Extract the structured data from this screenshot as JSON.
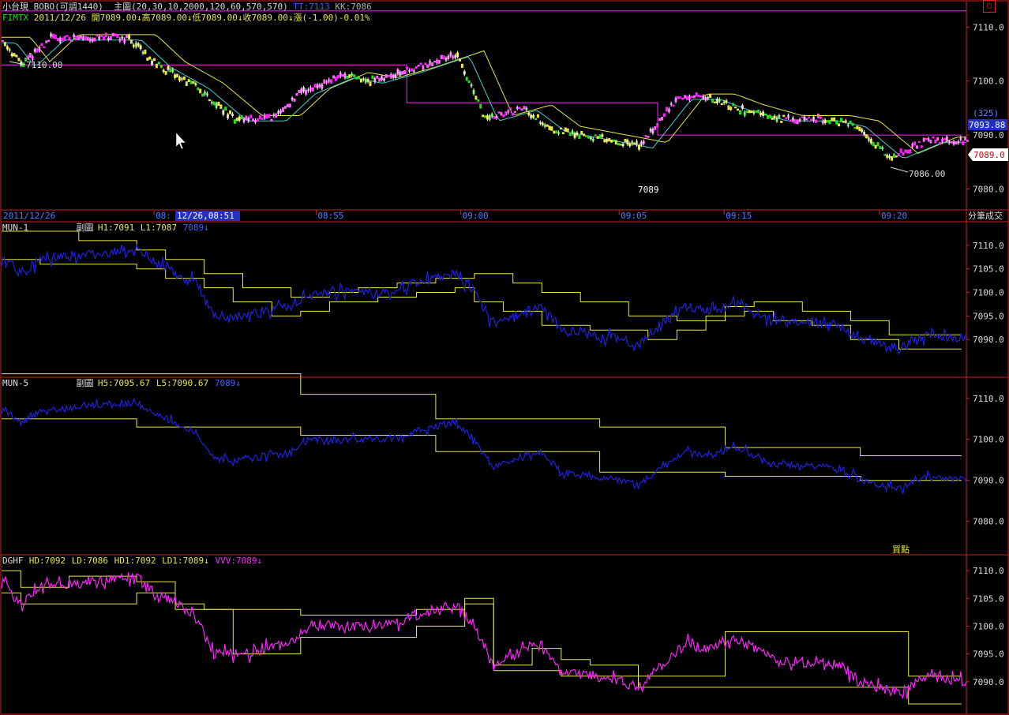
{
  "header": {
    "line1_title": "小台現",
    "line1_system": "BOBO(可調1440)",
    "line1_main": "主圖(20,30,10,2000,120,60,570,570)",
    "line1_tt": "TT:7113",
    "line1_kk": "KK:7086",
    "line2_symbol": "FIMTX",
    "line2_quote": "2011/12/26 開7089.00↓高7089.00↓低7089.00↓收7089.00↓漲(-1.00)-0.01%"
  },
  "colors": {
    "background": "#000000",
    "frame": "#cc2222",
    "yellow": "#e8e840",
    "blue": "#2020e0",
    "magenta": "#ff20ff",
    "green": "#20e020",
    "cyan": "#40d0d0",
    "axis_text": "#dddddd"
  },
  "time_axis": {
    "date": "2011/12/26",
    "cursor": "12/26,08:51",
    "ticks": [
      {
        "label": "08:",
        "t": 0.158
      },
      {
        "label": "08:55",
        "t": 0.326
      },
      {
        "label": "09:00",
        "t": 0.476
      },
      {
        "label": "09:05",
        "t": 0.64
      },
      {
        "label": "09:15",
        "t": 0.749
      },
      {
        "label": "09:20",
        "t": 0.91
      }
    ],
    "right_label": "分筆成交"
  },
  "panel1": {
    "annotation_high": "7110.00",
    "annotation_low": "7086.00",
    "annotation_price": "7089",
    "tag_count": "(325)",
    "tag_value": "7093.88",
    "tag_last": "7089.0"
  },
  "panel2": {
    "name": "MUN-1",
    "sub": "副圖",
    "h": "H1:7091",
    "l": "L1:7087",
    "v": "7089↓"
  },
  "panel3": {
    "name": "MUN-5",
    "sub": "副圖",
    "h": "H5:7095.67",
    "l": "L5:7090.67",
    "v": "7089↓",
    "signal": "買點"
  },
  "panel4": {
    "name": "DGHF",
    "hd": "HD:7092",
    "ld": "LD:7086",
    "hd1": "HD1:7092",
    "ld1": "LD1:7089↓",
    "vvv": "VVV:7089↓"
  },
  "chart_data": [
    {
      "type": "line",
      "name_panel": "main",
      "ylim": [
        7077,
        7114
      ],
      "yticks": [
        "7110.0",
        "7100.0",
        "7090.0",
        "7080.0"
      ],
      "ytick_values": [
        7110,
        7100,
        7090,
        7080
      ],
      "price_anchors": [
        [
          0,
          7107.5
        ],
        [
          0.02,
          7103
        ],
        [
          0.05,
          7108
        ],
        [
          0.13,
          7108
        ],
        [
          0.16,
          7103
        ],
        [
          0.2,
          7099
        ],
        [
          0.24,
          7093
        ],
        [
          0.28,
          7093
        ],
        [
          0.31,
          7098
        ],
        [
          0.35,
          7101
        ],
        [
          0.38,
          7100
        ],
        [
          0.42,
          7102
        ],
        [
          0.47,
          7105
        ],
        [
          0.5,
          7093
        ],
        [
          0.54,
          7095
        ],
        [
          0.57,
          7091
        ],
        [
          0.6,
          7090
        ],
        [
          0.66,
          7088
        ],
        [
          0.7,
          7097
        ],
        [
          0.73,
          7097
        ],
        [
          0.76,
          7095
        ],
        [
          0.8,
          7093
        ],
        [
          0.85,
          7093
        ],
        [
          0.88,
          7092
        ],
        [
          0.92,
          7086
        ],
        [
          0.96,
          7089
        ],
        [
          1.0,
          7089
        ]
      ],
      "upper_line": 7113,
      "lower_steps": [
        [
          0,
          7103
        ],
        [
          0.42,
          7096
        ],
        [
          0.68,
          7090
        ]
      ]
    },
    {
      "type": "line",
      "name_panel": "MUN-1",
      "ylim": [
        7083,
        7114
      ],
      "yticks": [
        "7110.0",
        "7105.0",
        "7100.0",
        "7095.0",
        "7090.0"
      ],
      "ytick_values": [
        7110,
        7105,
        7100,
        7095,
        7090
      ],
      "price_anchors": [
        [
          0,
          7108
        ],
        [
          0.02,
          7104
        ],
        [
          0.04,
          7107
        ],
        [
          0.14,
          7109
        ],
        [
          0.16,
          7106
        ],
        [
          0.2,
          7102
        ],
        [
          0.22,
          7095
        ],
        [
          0.25,
          7095
        ],
        [
          0.3,
          7097
        ],
        [
          0.32,
          7100
        ],
        [
          0.4,
          7100
        ],
        [
          0.43,
          7102
        ],
        [
          0.47,
          7104
        ],
        [
          0.49,
          7100
        ],
        [
          0.51,
          7093
        ],
        [
          0.54,
          7096
        ],
        [
          0.56,
          7097
        ],
        [
          0.58,
          7092
        ],
        [
          0.64,
          7090
        ],
        [
          0.66,
          7089
        ],
        [
          0.71,
          7097
        ],
        [
          0.73,
          7096
        ],
        [
          0.76,
          7098
        ],
        [
          0.8,
          7094
        ],
        [
          0.87,
          7093
        ],
        [
          0.89,
          7090
        ],
        [
          0.93,
          7088
        ],
        [
          0.96,
          7091
        ],
        [
          1.0,
          7090
        ]
      ],
      "upper_steps": [
        [
          0,
          7113
        ],
        [
          0.08,
          7111
        ],
        [
          0.14,
          7109
        ],
        [
          0.17,
          7107
        ],
        [
          0.21,
          7104
        ],
        [
          0.25,
          7101
        ],
        [
          0.3,
          7099
        ],
        [
          0.34,
          7100
        ],
        [
          0.37,
          7101
        ],
        [
          0.41,
          7102
        ],
        [
          0.45,
          7103
        ],
        [
          0.49,
          7104
        ],
        [
          0.53,
          7102
        ],
        [
          0.56,
          7100
        ],
        [
          0.6,
          7098
        ],
        [
          0.65,
          7095
        ],
        [
          0.7,
          7094
        ],
        [
          0.75,
          7097
        ],
        [
          0.78,
          7098
        ],
        [
          0.83,
          7096
        ],
        [
          0.88,
          7094
        ],
        [
          0.92,
          7091
        ],
        [
          0.96,
          7091
        ]
      ],
      "lower_steps": [
        [
          0,
          7107
        ],
        [
          0.04,
          7106
        ],
        [
          0.14,
          7105
        ],
        [
          0.17,
          7103
        ],
        [
          0.21,
          7101
        ],
        [
          0.24,
          7098
        ],
        [
          0.28,
          7095
        ],
        [
          0.31,
          7096
        ],
        [
          0.34,
          7098
        ],
        [
          0.39,
          7099
        ],
        [
          0.43,
          7100
        ],
        [
          0.47,
          7101
        ],
        [
          0.49,
          7098
        ],
        [
          0.52,
          7096
        ],
        [
          0.56,
          7093
        ],
        [
          0.61,
          7092
        ],
        [
          0.67,
          7090
        ],
        [
          0.7,
          7092
        ],
        [
          0.73,
          7095
        ],
        [
          0.77,
          7096
        ],
        [
          0.8,
          7094
        ],
        [
          0.84,
          7093
        ],
        [
          0.88,
          7090
        ],
        [
          0.93,
          7088
        ],
        [
          0.96,
          7088
        ]
      ]
    },
    {
      "type": "line",
      "name_panel": "MUN-5",
      "ylim": [
        7073,
        7114
      ],
      "yticks": [
        "7110.0",
        "7100.0",
        "7090.0",
        "7080.0"
      ],
      "ytick_values": [
        7110,
        7100,
        7090,
        7080
      ],
      "price_anchors": [
        [
          0,
          7108
        ],
        [
          0.02,
          7104
        ],
        [
          0.04,
          7107
        ],
        [
          0.14,
          7109
        ],
        [
          0.16,
          7106
        ],
        [
          0.2,
          7102
        ],
        [
          0.22,
          7095
        ],
        [
          0.25,
          7095
        ],
        [
          0.3,
          7097
        ],
        [
          0.32,
          7100
        ],
        [
          0.4,
          7100
        ],
        [
          0.43,
          7102
        ],
        [
          0.47,
          7104
        ],
        [
          0.49,
          7100
        ],
        [
          0.51,
          7093
        ],
        [
          0.54,
          7096
        ],
        [
          0.56,
          7097
        ],
        [
          0.58,
          7092
        ],
        [
          0.64,
          7090
        ],
        [
          0.66,
          7089
        ],
        [
          0.71,
          7097
        ],
        [
          0.73,
          7096
        ],
        [
          0.76,
          7098
        ],
        [
          0.8,
          7094
        ],
        [
          0.87,
          7093
        ],
        [
          0.89,
          7090
        ],
        [
          0.93,
          7088
        ],
        [
          0.96,
          7091
        ],
        [
          1.0,
          7090
        ]
      ],
      "upper_steps": [
        [
          0,
          7116
        ],
        [
          0.31,
          7111
        ],
        [
          0.45,
          7105
        ],
        [
          0.62,
          7103
        ],
        [
          0.75,
          7098
        ],
        [
          0.89,
          7096
        ]
      ],
      "lower_steps": [
        [
          0,
          7105
        ],
        [
          0.14,
          7103
        ],
        [
          0.31,
          7101
        ],
        [
          0.45,
          7097
        ],
        [
          0.62,
          7092
        ],
        [
          0.75,
          7091
        ],
        [
          0.89,
          7090
        ]
      ]
    },
    {
      "type": "line",
      "name_panel": "DGHF",
      "ylim": [
        7085,
        7112
      ],
      "yticks": [
        "7110.0",
        "7105.0",
        "7100.0",
        "7095.0",
        "7090.0"
      ],
      "ytick_values": [
        7110,
        7105,
        7100,
        7095,
        7090
      ],
      "price_anchors": [
        [
          0,
          7108
        ],
        [
          0.02,
          7104
        ],
        [
          0.04,
          7107
        ],
        [
          0.14,
          7109
        ],
        [
          0.16,
          7106
        ],
        [
          0.2,
          7102
        ],
        [
          0.22,
          7095
        ],
        [
          0.25,
          7095
        ],
        [
          0.3,
          7097
        ],
        [
          0.32,
          7100
        ],
        [
          0.4,
          7100
        ],
        [
          0.43,
          7102
        ],
        [
          0.47,
          7104
        ],
        [
          0.49,
          7100
        ],
        [
          0.51,
          7093
        ],
        [
          0.54,
          7096
        ],
        [
          0.56,
          7097
        ],
        [
          0.58,
          7092
        ],
        [
          0.64,
          7090
        ],
        [
          0.66,
          7089
        ],
        [
          0.71,
          7097
        ],
        [
          0.73,
          7096
        ],
        [
          0.76,
          7098
        ],
        [
          0.8,
          7094
        ],
        [
          0.87,
          7093
        ],
        [
          0.89,
          7090
        ],
        [
          0.93,
          7088
        ],
        [
          0.96,
          7091
        ],
        [
          1.0,
          7090
        ]
      ],
      "upper_steps": [
        [
          0,
          7110
        ],
        [
          0.02,
          7107
        ],
        [
          0.07,
          7109
        ],
        [
          0.14,
          7108
        ],
        [
          0.18,
          7104
        ],
        [
          0.21,
          7103
        ],
        [
          0.31,
          7102
        ],
        [
          0.43,
          7103
        ],
        [
          0.48,
          7105
        ],
        [
          0.51,
          7093
        ],
        [
          0.55,
          7096
        ],
        [
          0.58,
          7094
        ],
        [
          0.61,
          7093
        ],
        [
          0.66,
          7091
        ],
        [
          0.75,
          7099
        ],
        [
          0.82,
          7099
        ],
        [
          0.94,
          7091
        ]
      ],
      "lower_steps": [
        [
          0,
          7106
        ],
        [
          0.02,
          7104
        ],
        [
          0.14,
          7106
        ],
        [
          0.18,
          7103
        ],
        [
          0.24,
          7095
        ],
        [
          0.31,
          7098
        ],
        [
          0.43,
          7100
        ],
        [
          0.48,
          7104
        ],
        [
          0.51,
          7092
        ],
        [
          0.58,
          7091
        ],
        [
          0.66,
          7089
        ],
        [
          0.94,
          7086
        ]
      ]
    }
  ]
}
